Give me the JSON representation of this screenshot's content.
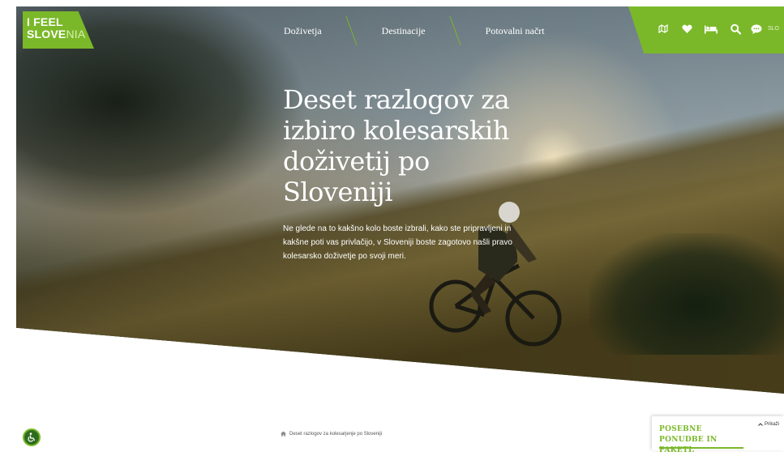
{
  "brand": {
    "logo_line1": "I FEEL",
    "logo_line2_bold": "SLOVE",
    "logo_line2_thin": "NIA",
    "accent_color": "#7ab829"
  },
  "nav": {
    "items": [
      {
        "label": "Doživetja"
      },
      {
        "label": "Destinacije"
      },
      {
        "label": "Potovalni načrt"
      }
    ]
  },
  "toolbar": {
    "icons": [
      "map-icon",
      "heart-icon",
      "bed-icon",
      "search-icon",
      "chat-icon"
    ],
    "language": "SLO"
  },
  "hero": {
    "title": "Deset razlogov za izbiro kolesarskih doživetij po Sloveniji",
    "intro": "Ne glede na to kakšno kolo boste izbrali, kako ste pripravljeni in kakšne poti vas privlačijo, v Sloveniji boste zagotovo našli pravo kolesarsko doživetje po svoji meri."
  },
  "breadcrumb": {
    "current": "Deset razlogov za kolesarjenje po Sloveniji"
  },
  "offer_panel": {
    "title": "POSEBNE PONUDBE IN PAKETI.",
    "toggle_label": "Prikaži"
  }
}
